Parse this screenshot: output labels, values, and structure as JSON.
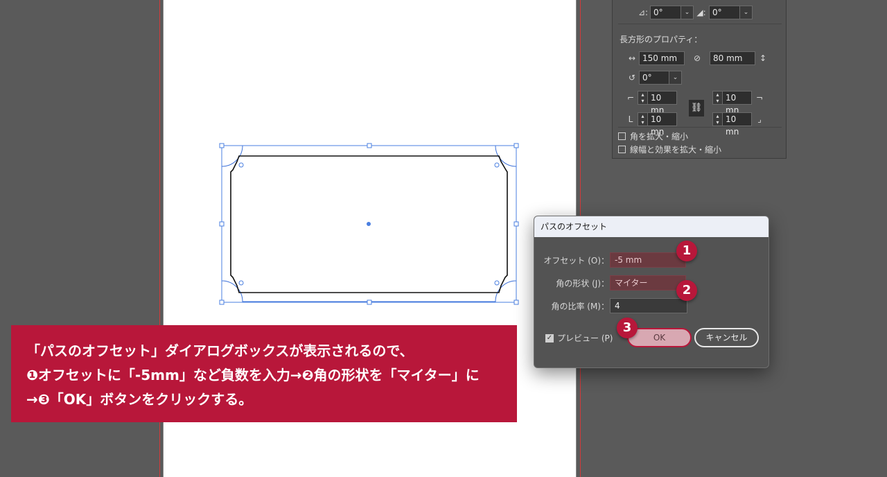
{
  "panel": {
    "angle1": "0°",
    "angle2": "0°",
    "section_title": "長方形のプロパティ：",
    "width": "150 mm",
    "height": "80 mm",
    "rotation": "0°",
    "corner_tl": "10 mn",
    "corner_tr": "10 mn",
    "corner_bl": "10 mn",
    "corner_br": "10 mn",
    "check_scale_corners": "角を拡大・縮小",
    "check_scale_strokes": "線幅と効果を拡大・縮小"
  },
  "dialog": {
    "title": "パスのオフセット",
    "offset_label": "オフセット (O)：",
    "offset_value": "-5 mm",
    "join_label": "角の形状 (J)：",
    "join_value": "マイター",
    "miter_label": "角の比率 (M)：",
    "miter_value": "4",
    "preview_label": "プレビュー (P)",
    "ok_label": "OK",
    "cancel_label": "キャンセル"
  },
  "badges": [
    "1",
    "2",
    "3"
  ],
  "caption": {
    "line1": "「パスのオフセット」ダイアログボックスが表示されるので、",
    "line2": "❶オフセットに「-5mm」など負数を入力→❷角の形状を「マイター」に",
    "line3": "→❸「OK」ボタンをクリックする。"
  },
  "colors": {
    "accent": "#b8173a",
    "selection": "#4a7fe0"
  }
}
